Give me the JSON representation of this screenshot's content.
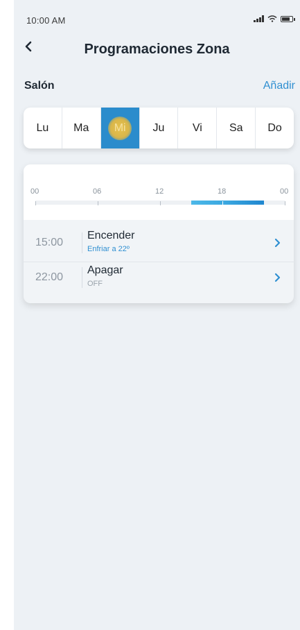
{
  "status_bar": {
    "time": "10:00 AM",
    "icons": [
      "signal-icon",
      "wifi-icon",
      "battery-icon"
    ]
  },
  "header": {
    "title": "Programaciones Zona",
    "back_icon": "chevron-left-icon"
  },
  "zone": {
    "name": "Salón",
    "add_label": "Añadir"
  },
  "days": [
    {
      "label": "Lu",
      "selected": false
    },
    {
      "label": "Ma",
      "selected": false
    },
    {
      "label": "Mi",
      "selected": true
    },
    {
      "label": "Ju",
      "selected": false
    },
    {
      "label": "Vi",
      "selected": false
    },
    {
      "label": "Sa",
      "selected": false
    },
    {
      "label": "Do",
      "selected": false
    }
  ],
  "timeline": {
    "tick_labels": [
      "00",
      "06",
      "12",
      "18",
      "00"
    ],
    "active_range_hours": [
      15,
      22
    ]
  },
  "events": [
    {
      "time": "15:00",
      "action": "Encender",
      "detail": "Enfriar a 22º",
      "detail_color": "#2f8fd1"
    },
    {
      "time": "22:00",
      "action": "Apagar",
      "detail": "OFF",
      "detail_color": "#9aa3ac"
    }
  ],
  "colors": {
    "accent": "#2f8fd1",
    "selected_day": "#2b8ccc",
    "background": "#edf1f5"
  }
}
